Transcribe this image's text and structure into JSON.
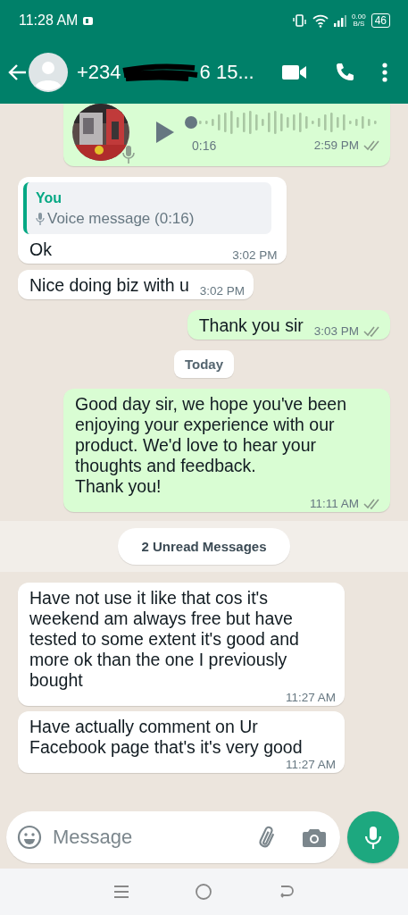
{
  "status_bar": {
    "time": "11:28 AM",
    "speed_value": "0.00",
    "speed_unit": "B/S",
    "battery": "46"
  },
  "header": {
    "contact_start": "+234",
    "contact_end": "6 15..."
  },
  "messages": [
    {
      "kind": "voice",
      "outgoing": true,
      "duration": "0:16",
      "time": "2:59 PM"
    },
    {
      "kind": "quote",
      "outgoing": false,
      "quote_author": "You",
      "quote_text": "Voice message (0:16)",
      "text": "Ok",
      "time": "3:02 PM"
    },
    {
      "kind": "text",
      "outgoing": false,
      "text": "Nice doing biz with u",
      "time": "3:02 PM"
    },
    {
      "kind": "text",
      "outgoing": true,
      "text": "Thank you sir",
      "time": "3:03 PM"
    },
    {
      "kind": "date",
      "text": "Today"
    },
    {
      "kind": "text",
      "outgoing": true,
      "text": "Good day sir, we hope you've been enjoying your experience with our product. We'd love to hear your thoughts and feedback.\nThank you!",
      "time": "11:11 AM"
    },
    {
      "kind": "unread",
      "text": "2 Unread Messages"
    },
    {
      "kind": "text",
      "outgoing": false,
      "text": "Have not use it like that cos it's weekend am always free but have tested to some extent it's good and more ok than the one I previously bought",
      "time": "11:27 AM"
    },
    {
      "kind": "text",
      "outgoing": false,
      "text": "Have actually comment on Ur Facebook page that's it's very good",
      "time": "11:27 AM"
    }
  ],
  "composer": {
    "placeholder": "Message"
  }
}
